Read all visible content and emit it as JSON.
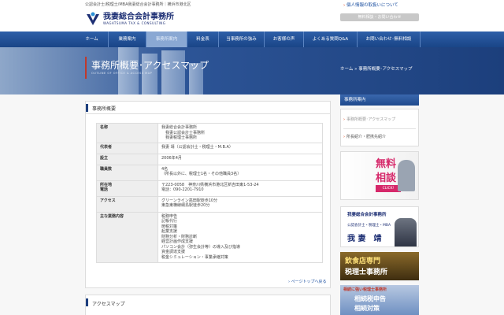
{
  "header": {
    "description": "公認会計士/税理士/MBA我妻総合会計事務所｜横浜市港北区",
    "logo_jp": "我妻総合会計事務所",
    "logo_en": "WAGATSUMA TAX & CONSULTING",
    "privacy_link": "個人情報の取扱いについて",
    "consult_button": "無料相談・お問い合わせ"
  },
  "nav": {
    "items": [
      {
        "label": "ホーム"
      },
      {
        "label": "業務案内"
      },
      {
        "label": "事務所案内"
      },
      {
        "label": "料金表"
      },
      {
        "label": "当事務所の強み"
      },
      {
        "label": "お客様の声"
      },
      {
        "label": "よくある質問Q&A"
      },
      {
        "label": "お問い合わせ･無料相談"
      }
    ],
    "active_index": 2
  },
  "hero": {
    "title": "事務所概要･アクセスマップ",
    "subtitle": "OUTLINE OF OFFICE & ACCESS MAP",
    "breadcrumb": "ホーム » 事務所概要･アクセスマップ"
  },
  "main": {
    "section_title": "事務所概要",
    "rows": [
      {
        "key": "名称",
        "value": "我妻総合会計事務所\n　我妻公認会計士事務所\n　我妻税理士事務所"
      },
      {
        "key": "代表者",
        "value": "我妻 靖（公認会計士・税理士・M.B.A）"
      },
      {
        "key": "設立",
        "value": "2006年4月"
      },
      {
        "key": "職員数",
        "value": "4名\n（所長以外に、税理士1名・その他職員3名）"
      },
      {
        "key": "所在地\n電話",
        "value": "〒223-0058　神奈川県横浜市港北区新吉田東1-53-24\n電話：090-2201-7910"
      },
      {
        "key": "アクセス",
        "value": "グリーンライン高田駅徒歩10分\n東急東横線綱島駅徒歩20分"
      },
      {
        "key": "主な業務内容",
        "value": "税務申告\n記帳代行\n節税対策\n起業支援\n財務分析・財務診断\n経営計画作成支援\nパソコン会計（弥生会計等）の導入及び指導\n資金調達支援\n税金シミュレーション・事業承継対策"
      }
    ],
    "page_top": "ページトップへ戻る",
    "section2_title": "アクセスマップ"
  },
  "sidebar": {
    "head": "事務所案内",
    "links": [
      {
        "label": "事務所概要･アクセスマップ"
      },
      {
        "label": "所長紹介・肥携先紹介"
      }
    ],
    "banner_free": {
      "line1": "無料",
      "line2": "相談",
      "line3": "CLICK!"
    },
    "banner_profile": {
      "office": "我妻総合会計事務所",
      "title": "公認会計士・税理士・MBA",
      "name": "我 妻　靖"
    },
    "banner_restaurant": {
      "line1": "飲食店専門",
      "line2": "税理士事務所"
    },
    "banner_inherit": {
      "line1": "相続に強い税理士事務所",
      "line2": "相続税申告",
      "line3": "相続対策"
    }
  },
  "colors": {
    "navy": "#1d3f7e",
    "nav_bg": "#2e5fa8",
    "accent_red": "#c0392b",
    "link": "#1b4fa0"
  }
}
